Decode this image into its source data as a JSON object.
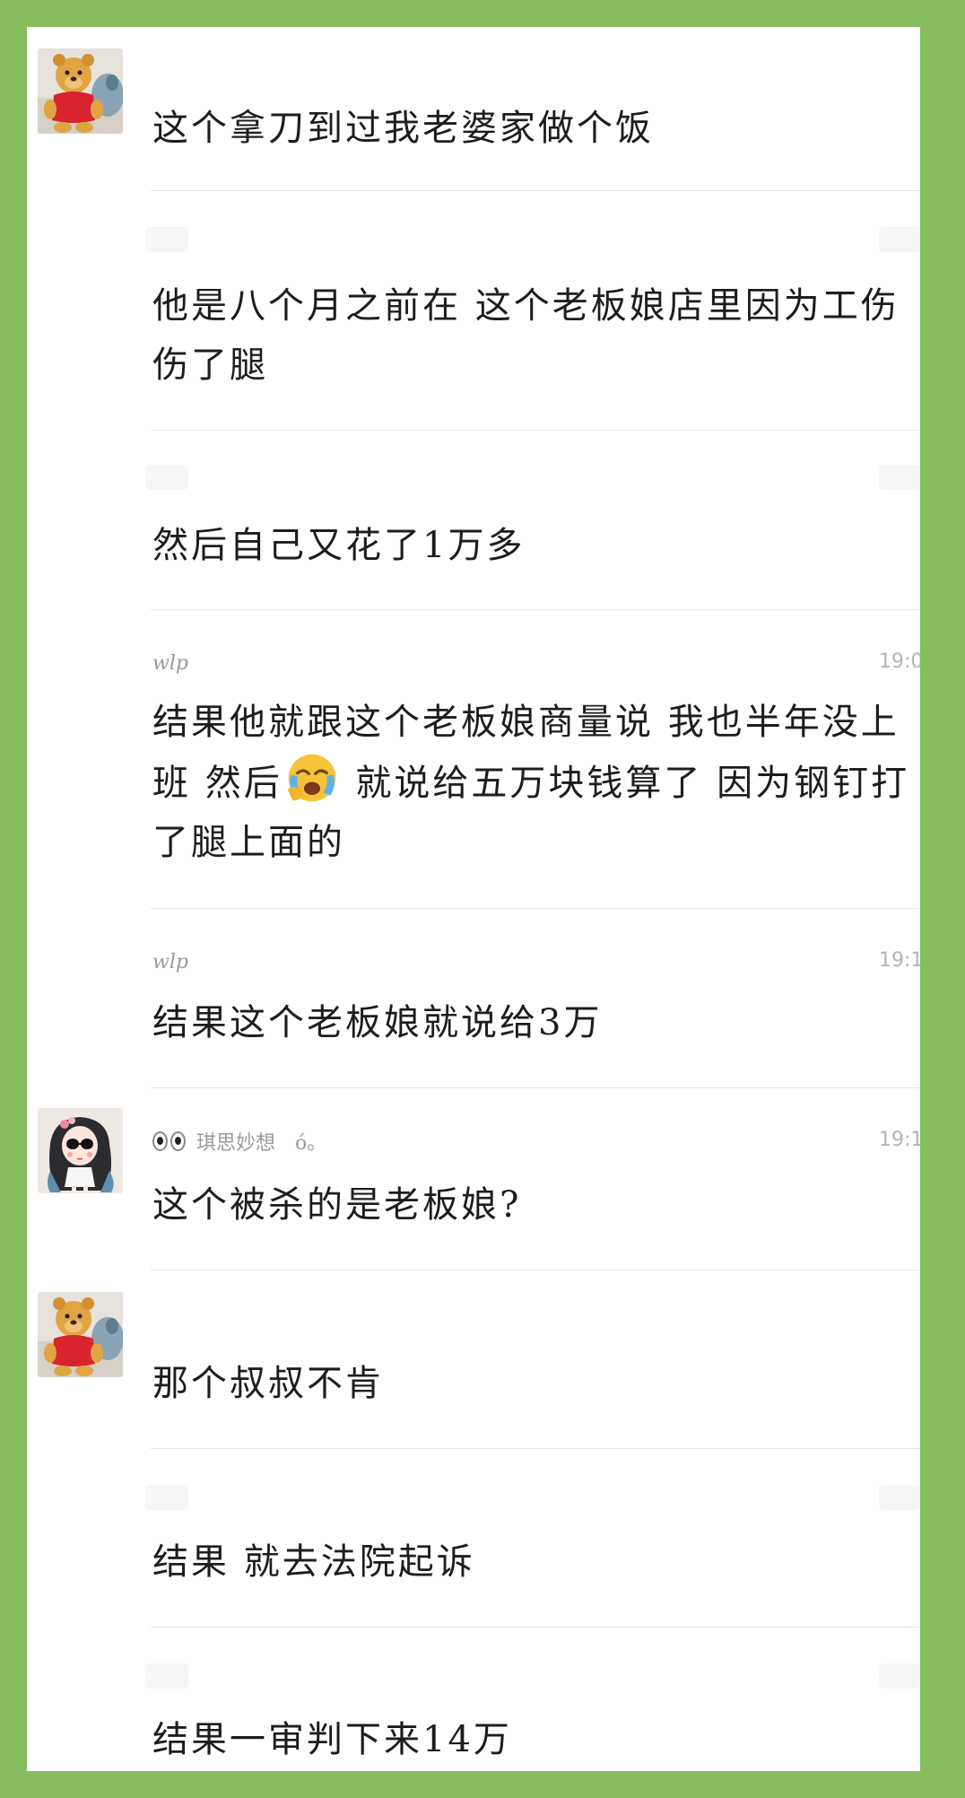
{
  "messages": [
    {
      "text": "这个拿刀到过我老婆家做个饭"
    },
    {
      "text": "他是八个月之前在 这个老板娘店里因为工伤 伤了腿"
    },
    {
      "text": "然后自己又花了1万多"
    },
    {
      "sender": "wlp",
      "time": "19:0",
      "text_before": "结果他就跟这个老板娘商量说 我也半年没上班 然后",
      "emoji": "crying-face-icon",
      "text_after": " 就说给五万块钱算了 因为钢钉打了腿上面的"
    },
    {
      "sender": "wlp",
      "time": "19:1",
      "text": "结果这个老板娘就说给3万"
    },
    {
      "sender": "琪思妙想",
      "sender_suffix": "ó。",
      "time": "19:1",
      "text": "这个被杀的是老板娘?"
    },
    {
      "text": "那个叔叔不肯"
    },
    {
      "text": "结果 就去法院起诉"
    },
    {
      "text": "结果一审判下来14万"
    }
  ],
  "colors": {
    "frame": "#86bd5f",
    "panel": "#ffffff",
    "text": "#1d1d1d",
    "meta": "#9a9a9a",
    "divider": "#e6e6e6"
  }
}
